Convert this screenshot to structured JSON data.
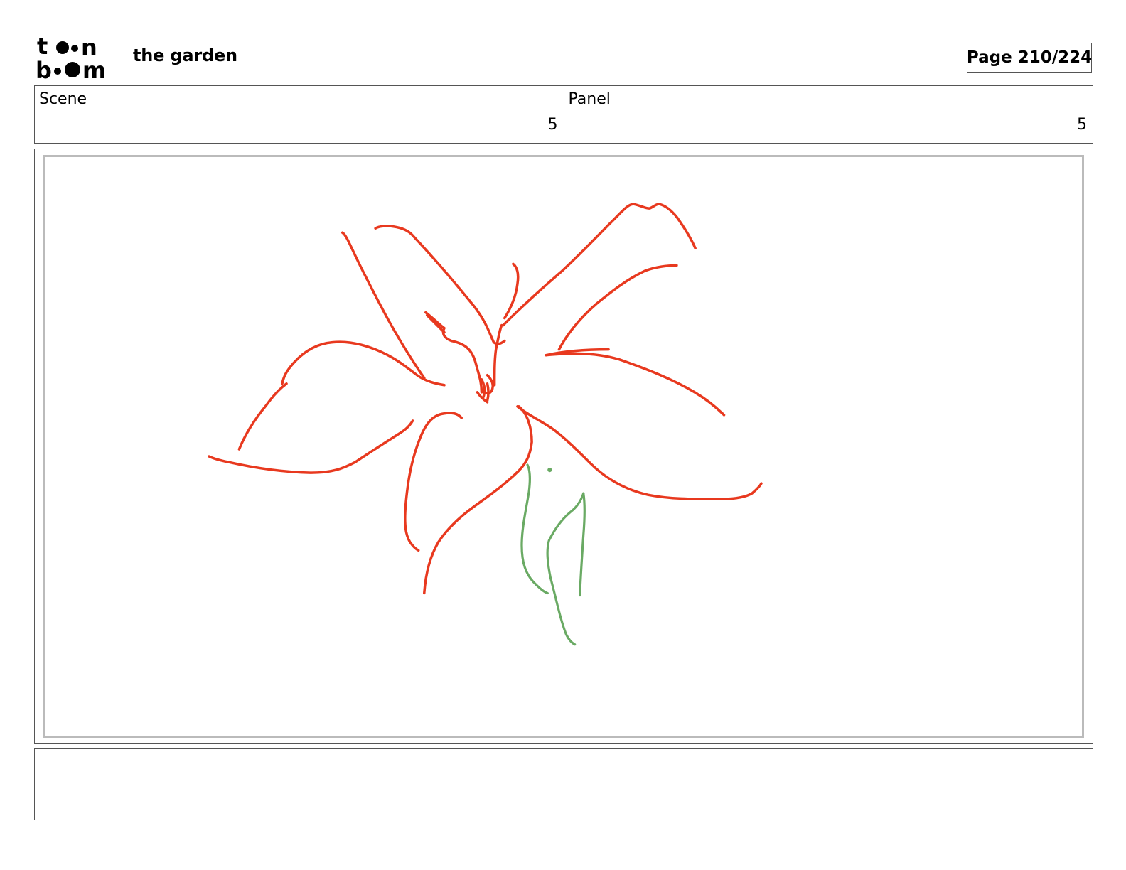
{
  "header": {
    "logo_text": [
      "to",
      "on",
      "bo",
      "om"
    ],
    "logo_name": "toon boom",
    "project_title": "the garden",
    "page_label": "Page 210/224"
  },
  "info": {
    "scene_label": "Scene",
    "scene_value": "5",
    "panel_label": "Panel",
    "panel_value": "5"
  },
  "drawing": {
    "subject": "flower sketch",
    "petal_color": "#e8391f",
    "stem_color": "#6aaa64"
  },
  "notes": {
    "text": ""
  }
}
